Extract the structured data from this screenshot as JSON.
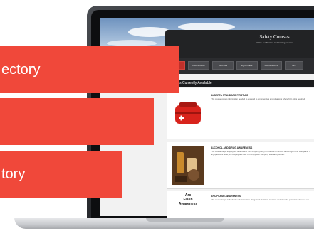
{
  "banners": [
    "ectory",
    "",
    "tory"
  ],
  "site": {
    "title": "Safety Courses",
    "subtitle": "Online certification and training courses"
  },
  "nav": [
    {
      "label": "",
      "active": true
    },
    {
      "label": "INDUSTRIAL"
    },
    {
      "label": "DRIVING"
    },
    {
      "label": "EQUIPMENT"
    },
    {
      "label": "HAZARDOUS"
    },
    {
      "label": "ALL"
    }
  ],
  "section_title": "Courses Currently Available",
  "courses": [
    {
      "title": "ALBERTA STANDARD FIRST AID",
      "desc": "This course covers information needed to respond to emergencies and situations where first aid is required."
    },
    {
      "title": "ALCOHOL AND DRUG AWARENESS",
      "desc": "This course helps employees understand the company policy on the use of alcohol and drugs in the workplace. If any questions arise, the employee's duty to comply with company standard policies."
    },
    {
      "title": "ARC FLASH AWARENESS",
      "desc": "This course helps individuals understand the dangers of electrical arc flash and what the potential outcomes are.",
      "thumb_text": [
        "Arc",
        "Flash",
        "Awareness"
      ]
    }
  ],
  "colors": {
    "banner": "#f0483a",
    "header": "#222325",
    "accent": "#c0302a"
  }
}
